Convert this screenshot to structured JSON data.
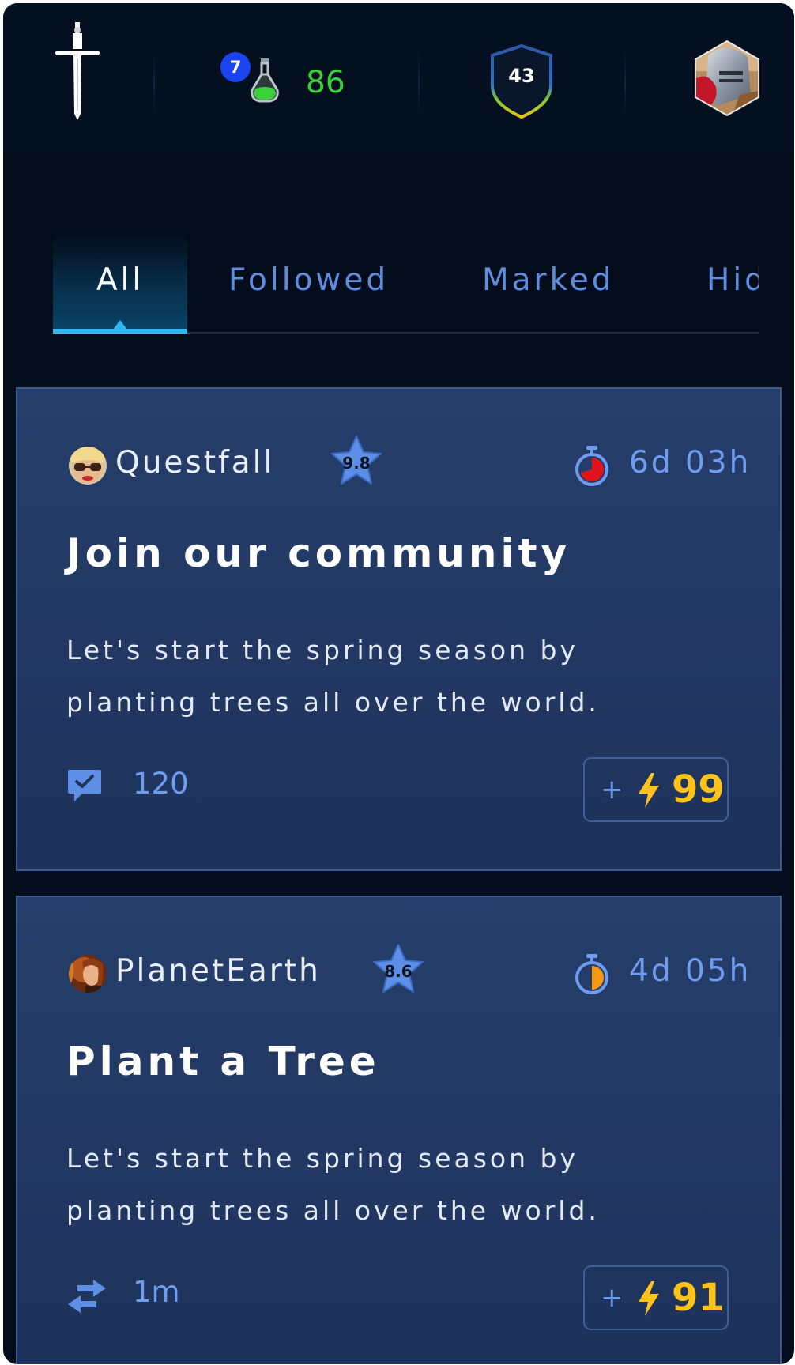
{
  "header": {
    "level": "7",
    "potion_count": "86",
    "shield_value": "43",
    "icons": {
      "sword": "sword-icon",
      "potion": "potion-icon",
      "shield": "shield-icon",
      "avatar": "knight-avatar"
    }
  },
  "tabs": [
    {
      "label": "All",
      "active": true
    },
    {
      "label": "Followed",
      "active": false
    },
    {
      "label": "Marked",
      "active": false
    },
    {
      "label": "Hidden",
      "active": false
    }
  ],
  "cards": [
    {
      "author": "Questfall",
      "rating": "9.8",
      "time_left": "6d 03h",
      "title": "Join our community",
      "description": "Let's start the spring season by planting trees all over the world.",
      "stat_icon": "comment-icon",
      "stat_value": "120",
      "reward_plus": "+",
      "reward_value": "99"
    },
    {
      "author": "PlanetEarth",
      "rating": "8.6",
      "time_left": "4d 05h",
      "title": "Plant a Tree",
      "description": "Let's start the spring season by planting trees all over the world.",
      "stat_icon": "swap-arrows-icon",
      "stat_value": "1m",
      "reward_plus": "+",
      "reward_value": "91"
    }
  ],
  "colors": {
    "background": "#030c1a",
    "card": "#233a66",
    "accent_blue": "#6e9cf0",
    "tab_indicator": "#2fb8f2",
    "reward_gold": "#ffc21a",
    "potion_green": "#3bd13a",
    "level_badge": "#1a44f0"
  }
}
